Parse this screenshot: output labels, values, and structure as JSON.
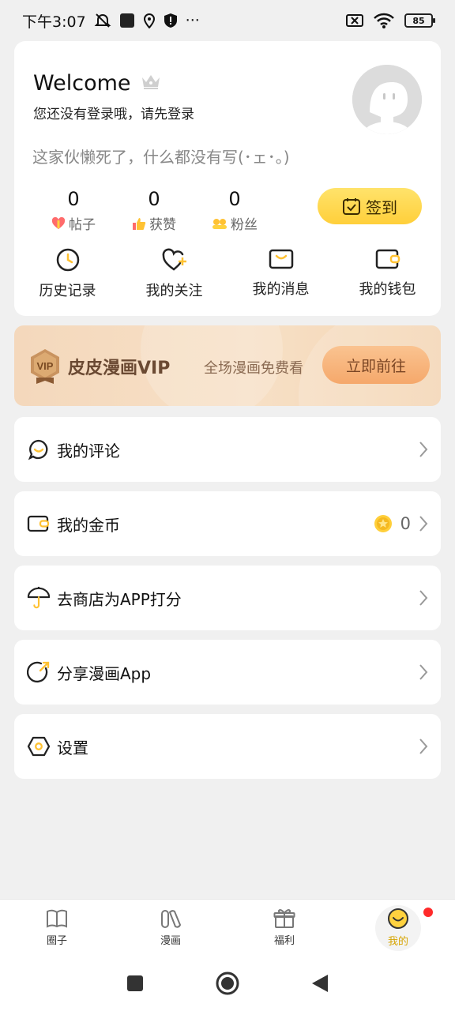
{
  "status_bar": {
    "time": "下午3:07",
    "battery": "85",
    "more": "···"
  },
  "profile": {
    "welcome": "Welcome",
    "login_prompt": "您还没有登录哦，请先登录",
    "bio": "这家伙懒死了，什么都没有写(･ェ･。)",
    "stats": [
      {
        "value": "0",
        "label": "帖子"
      },
      {
        "value": "0",
        "label": "获赞"
      },
      {
        "value": "0",
        "label": "粉丝"
      }
    ],
    "signin_label": "签到",
    "shortcuts": [
      {
        "label": "历史记录",
        "icon": "clock-icon"
      },
      {
        "label": "我的关注",
        "icon": "heart-plus-icon"
      },
      {
        "label": "我的消息",
        "icon": "message-icon"
      },
      {
        "label": "我的钱包",
        "icon": "wallet-icon"
      }
    ]
  },
  "vip": {
    "badge": "VIP",
    "title": "皮皮漫画VIP",
    "desc": "全场漫画免费看",
    "button": "立即前往"
  },
  "menu": {
    "comments": "我的评论",
    "coins": "我的金币",
    "coins_value": "0",
    "rate": "去商店为APP打分",
    "share": "分享漫画App",
    "settings": "设置"
  },
  "bottom_nav": [
    {
      "label": "圈子",
      "icon": "book-icon"
    },
    {
      "label": "漫画",
      "icon": "comic-icon"
    },
    {
      "label": "福利",
      "icon": "gift-icon"
    },
    {
      "label": "我的",
      "icon": "smiley-icon"
    }
  ],
  "colors": {
    "accent_yellow": "#ffd23f",
    "vip_bg": "#f4d8bc",
    "active_nav": "#d6a400",
    "badge_red": "#ff2a2a"
  }
}
